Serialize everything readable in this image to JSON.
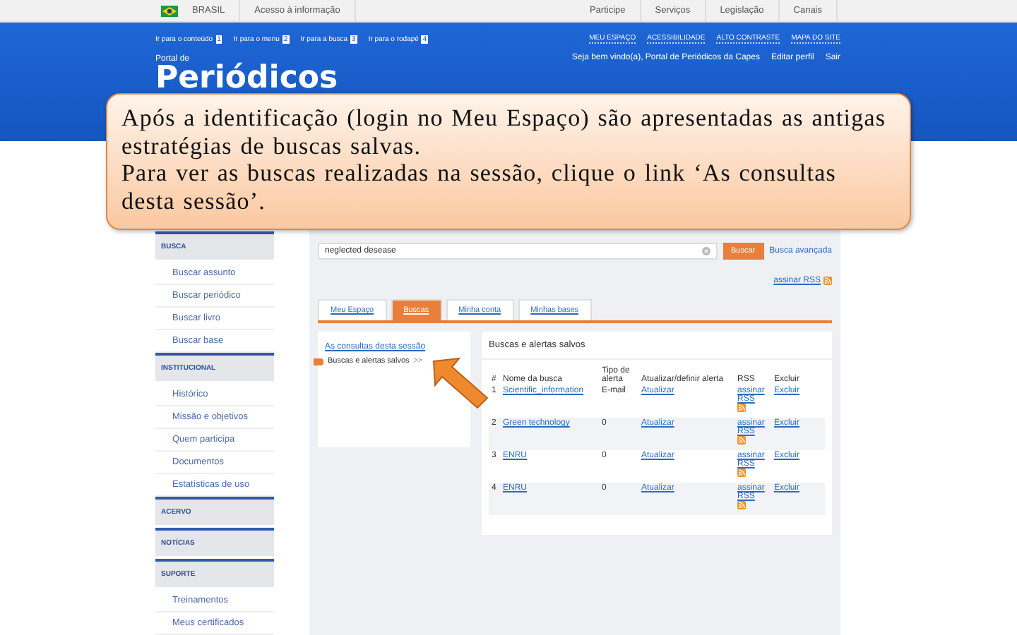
{
  "gov_bar": {
    "country": "BRASIL",
    "access": "Acesso à informação",
    "links": [
      "Participe",
      "Serviços",
      "Legislação",
      "Canais"
    ]
  },
  "header": {
    "skip_links": [
      {
        "label": "Ir para o conteúdo",
        "key": "1"
      },
      {
        "label": "Ir para o menu",
        "key": "2"
      },
      {
        "label": "Ir para a busca",
        "key": "3"
      },
      {
        "label": "Ir para o rodapé",
        "key": "4"
      }
    ],
    "top_links": [
      "MEU ESPAÇO",
      "ACESSIBILIDADE",
      "ALTO CONTRASTE",
      "MAPA DO SITE"
    ],
    "welcome": "Seja bem vindo(a), Portal de Periódicos da Capes",
    "user_links": [
      "Editar perfil",
      "Sair"
    ],
    "subtitle": "Portal de",
    "title": "Periódicos"
  },
  "sidebar": [
    {
      "heading": "BUSCA",
      "items": [
        "Buscar assunto",
        "Buscar periódico",
        "Buscar livro",
        "Buscar base"
      ]
    },
    {
      "heading": "INSTITUCIONAL",
      "items": [
        "Histórico",
        "Missão e objetivos",
        "Quem participa",
        "Documentos",
        "Estatísticas de uso"
      ]
    },
    {
      "heading": "ACERVO"
    },
    {
      "heading": "NOTÍCIAS"
    },
    {
      "heading": "SUPORTE",
      "items": [
        "Treinamentos",
        "Meus certificados"
      ]
    }
  ],
  "search": {
    "value": "neglected desease",
    "button": "Buscar",
    "advanced": "Busca avançada"
  },
  "rss_link": "assinar RSS",
  "tabs": [
    {
      "label": "Meu Espaço",
      "selected": false
    },
    {
      "label": "Buscas",
      "selected": true
    },
    {
      "label": "Minha conta",
      "selected": false
    },
    {
      "label": "Minhas bases",
      "selected": false
    }
  ],
  "side_panel": {
    "link": "As consultas desta sessão",
    "item": "Buscas e alertas salvos",
    "item_mark": ">>"
  },
  "table": {
    "title": "Buscas e alertas salvos",
    "columns": [
      "#",
      "Nome da busca",
      "Tipo de alerta",
      "Atualizar/definir alerta",
      "RSS",
      "Excluir"
    ],
    "rows": [
      {
        "n": "1",
        "name": "Scientific_information",
        "alert": "E-mail",
        "update": "Atualizar",
        "rss": "assinar RSS",
        "delete": "Excluir"
      },
      {
        "n": "2",
        "name": "Green technology",
        "alert": "0",
        "update": "Atualizar",
        "rss": "assinar RSS",
        "delete": "Excluir"
      },
      {
        "n": "3",
        "name": "ENRU",
        "alert": "0",
        "update": "Atualizar",
        "rss": "assinar RSS",
        "delete": "Excluir"
      },
      {
        "n": "4",
        "name": "ENRU",
        "alert": "0",
        "update": "Atualizar",
        "rss": "assinar RSS",
        "delete": "Excluir"
      }
    ]
  },
  "callout": {
    "paragraphs": [
      "Após a identificação (login no Meu Espaço) são apresentadas as antigas estratégias de buscas salvas.",
      "Para ver as buscas realizadas na sessão,  clique o link  ‘As consultas desta sessão’."
    ]
  }
}
